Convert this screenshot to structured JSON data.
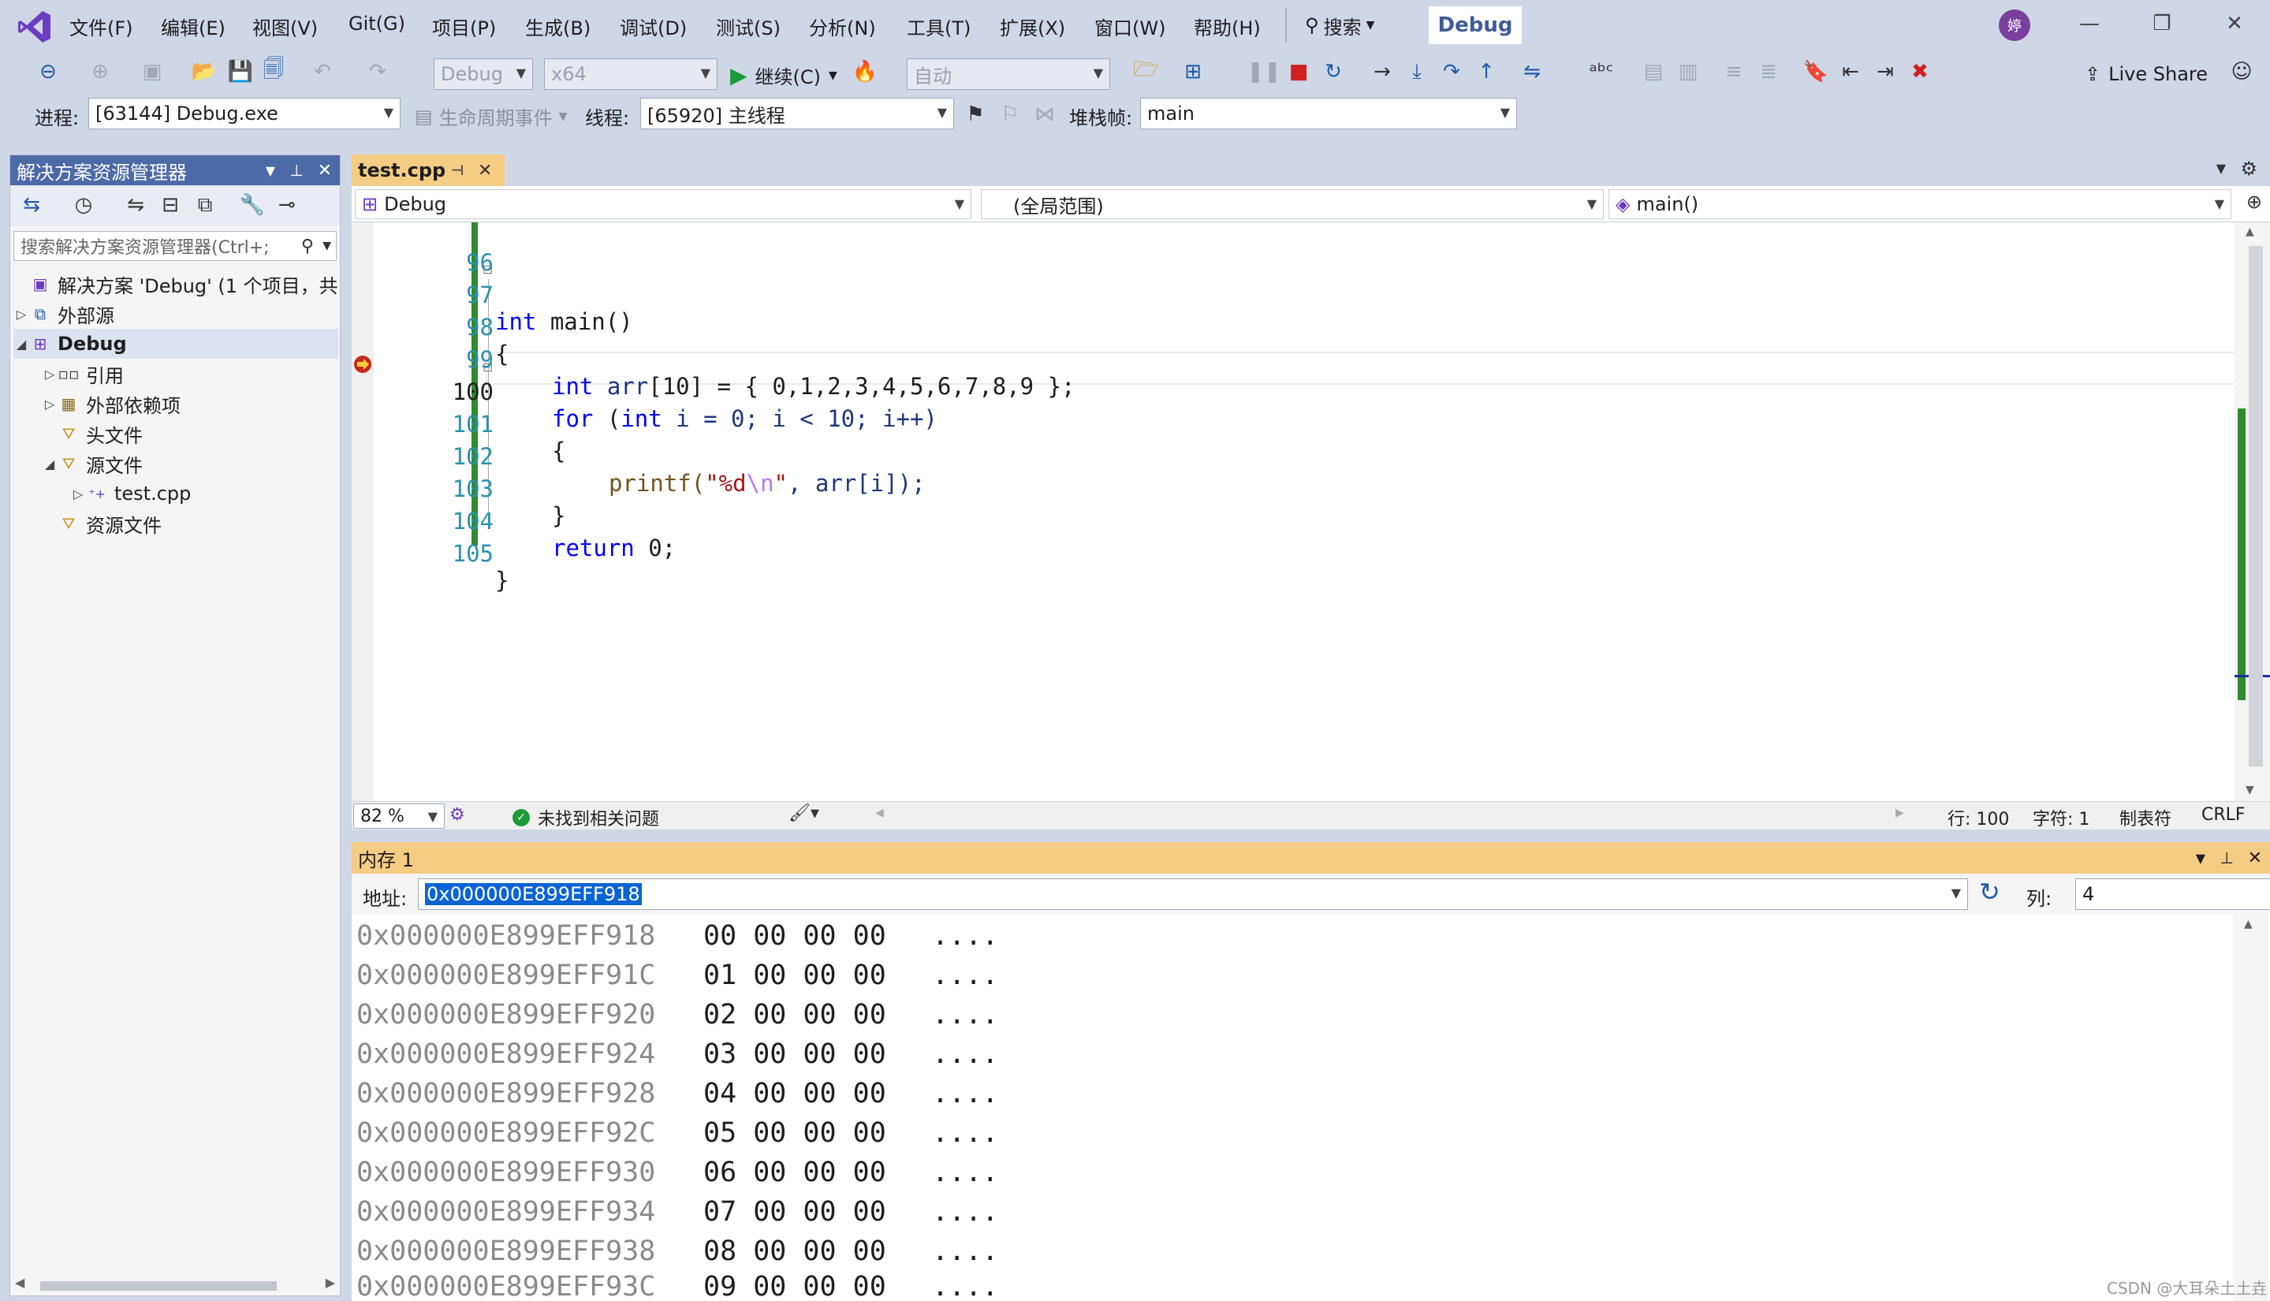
{
  "menu": [
    "文件(F)",
    "编辑(E)",
    "视图(V)",
    "Git(G)",
    "项目(P)",
    "生成(B)",
    "调试(D)",
    "测试(S)",
    "分析(N)",
    "工具(T)",
    "扩展(X)",
    "窗口(W)",
    "帮助(H)"
  ],
  "search_label": "搜索",
  "solution_config_badge": "Debug",
  "avatar_initial": "婷",
  "toolbar": {
    "config": "Debug",
    "platform": "x64",
    "continue_label": "继续(C)",
    "auto": "自动",
    "live_share": "Live Share"
  },
  "debug_bar": {
    "process_label": "进程:",
    "process_value": "[63144] Debug.exe",
    "lifecycle_label": "生命周期事件",
    "thread_label": "线程:",
    "thread_value": "[65920] 主线程",
    "stack_label": "堆栈帧:",
    "stack_value": "main"
  },
  "solution_explorer": {
    "title": "解决方案资源管理器",
    "search_placeholder": "搜索解决方案资源管理器(Ctrl+;",
    "items": [
      {
        "label": "解决方案 'Debug' (1 个项目，共"
      },
      {
        "label": "外部源"
      },
      {
        "label": "Debug"
      },
      {
        "label": "引用"
      },
      {
        "label": "外部依赖项"
      },
      {
        "label": "头文件"
      },
      {
        "label": "源文件"
      },
      {
        "label": "test.cpp"
      },
      {
        "label": "资源文件"
      }
    ]
  },
  "editor": {
    "tab": "test.cpp",
    "nav_project": "Debug",
    "nav_scope": "(全局范围)",
    "nav_member": "main()",
    "zoom": "82 %",
    "issues": "未找到相关问题",
    "line_info": "行: 100",
    "char_info": "字符: 1",
    "tab_mode": "制表符",
    "eol": "CRLF",
    "lines": [
      "96",
      "97",
      "98",
      "99",
      "100",
      "101",
      "102",
      "103",
      "104",
      "105"
    ],
    "code": {
      "l97_kw": "int",
      "l97_rest": " main()",
      "l98": "{",
      "l99_kw": "int",
      "l99_var": "arr",
      "l99_rest": "[10] = { 0,1,2,3,4,5,6,7,8,9 };",
      "l100_for": "for",
      "l100_open": " (",
      "l100_int": "int",
      "l100_rest": " i = 0; i < 10; i++)",
      "l101": "{",
      "l102_fn": "printf(",
      "l102_str1": "\"%d",
      "l102_esc": "\\n",
      "l102_str2": "\"",
      "l102_rest": ", arr[i]);",
      "l103": "}",
      "l104_kw": "return",
      "l104_rest": " 0;",
      "l105": "}"
    }
  },
  "memory": {
    "title": "内存 1",
    "address_label": "地址:",
    "address_value": "0x000000E899EFF918",
    "columns_label": "列:",
    "columns_value": "4",
    "rows": [
      {
        "addr": "0x000000E899EFF918",
        "bytes": "00 00 00 00",
        "ascii": "...."
      },
      {
        "addr": "0x000000E899EFF91C",
        "bytes": "01 00 00 00",
        "ascii": "...."
      },
      {
        "addr": "0x000000E899EFF920",
        "bytes": "02 00 00 00",
        "ascii": "...."
      },
      {
        "addr": "0x000000E899EFF924",
        "bytes": "03 00 00 00",
        "ascii": "...."
      },
      {
        "addr": "0x000000E899EFF928",
        "bytes": "04 00 00 00",
        "ascii": "...."
      },
      {
        "addr": "0x000000E899EFF92C",
        "bytes": "05 00 00 00",
        "ascii": "...."
      },
      {
        "addr": "0x000000E899EFF930",
        "bytes": "06 00 00 00",
        "ascii": "...."
      },
      {
        "addr": "0x000000E899EFF934",
        "bytes": "07 00 00 00",
        "ascii": "...."
      },
      {
        "addr": "0x000000E899EFF938",
        "bytes": "08 00 00 00",
        "ascii": "...."
      },
      {
        "addr": "0x000000E899EFF93C",
        "bytes": "09 00 00 00",
        "ascii": "...."
      }
    ]
  },
  "watermark": "CSDN @大耳朵土土垚",
  "colors": {
    "chrome": "#cfd6e5",
    "active_tab": "#f5cc84",
    "panel_header": "#4d6aa8",
    "keyword": "#0000ff",
    "string": "#a31515",
    "change_bar": "#2e8b2e"
  }
}
